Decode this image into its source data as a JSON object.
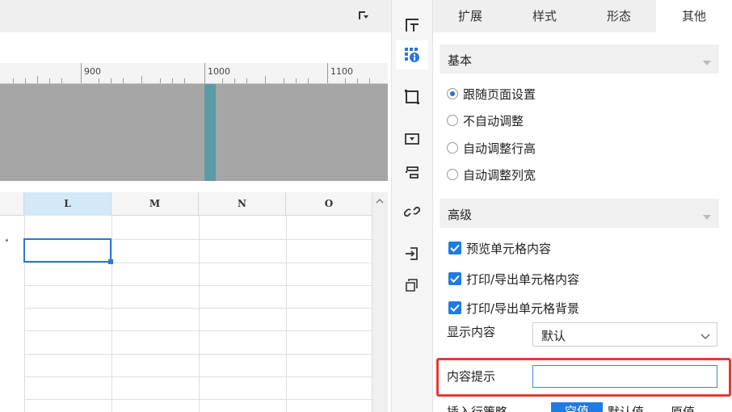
{
  "ruler": {
    "ticks": [
      "900",
      "1000",
      "1100"
    ]
  },
  "grid": {
    "columns": [
      "L",
      "M",
      "N",
      "O"
    ],
    "selected_column": "L"
  },
  "side_icons": [
    "grid-layout-icon",
    "cell-attributes-icon",
    "frame-icon",
    "widget-icon",
    "list-icon",
    "link-icon",
    "import-icon",
    "copy-rotate-icon"
  ],
  "tabs": [
    "扩展",
    "样式",
    "形态",
    "其他"
  ],
  "active_tab": "其他",
  "basic": {
    "title": "基本",
    "options": [
      "跟随页面设置",
      "不自动调整",
      "自动调整行高",
      "自动调整列宽"
    ],
    "selected": "跟随页面设置"
  },
  "advanced": {
    "title": "高级",
    "checks": [
      "预览单元格内容",
      "打印/导出单元格内容",
      "打印/导出单元格背景"
    ],
    "display_label": "显示内容",
    "display_value": "默认",
    "hint_label": "内容提示",
    "hint_value": "",
    "bottom_label": "插入行策略",
    "bottom_options": [
      "空值",
      "默认值",
      "原值"
    ]
  },
  "colors": {
    "accent": "#1e7be4",
    "highlight": "#e23b34",
    "selected_col": "#d3e9f8"
  }
}
